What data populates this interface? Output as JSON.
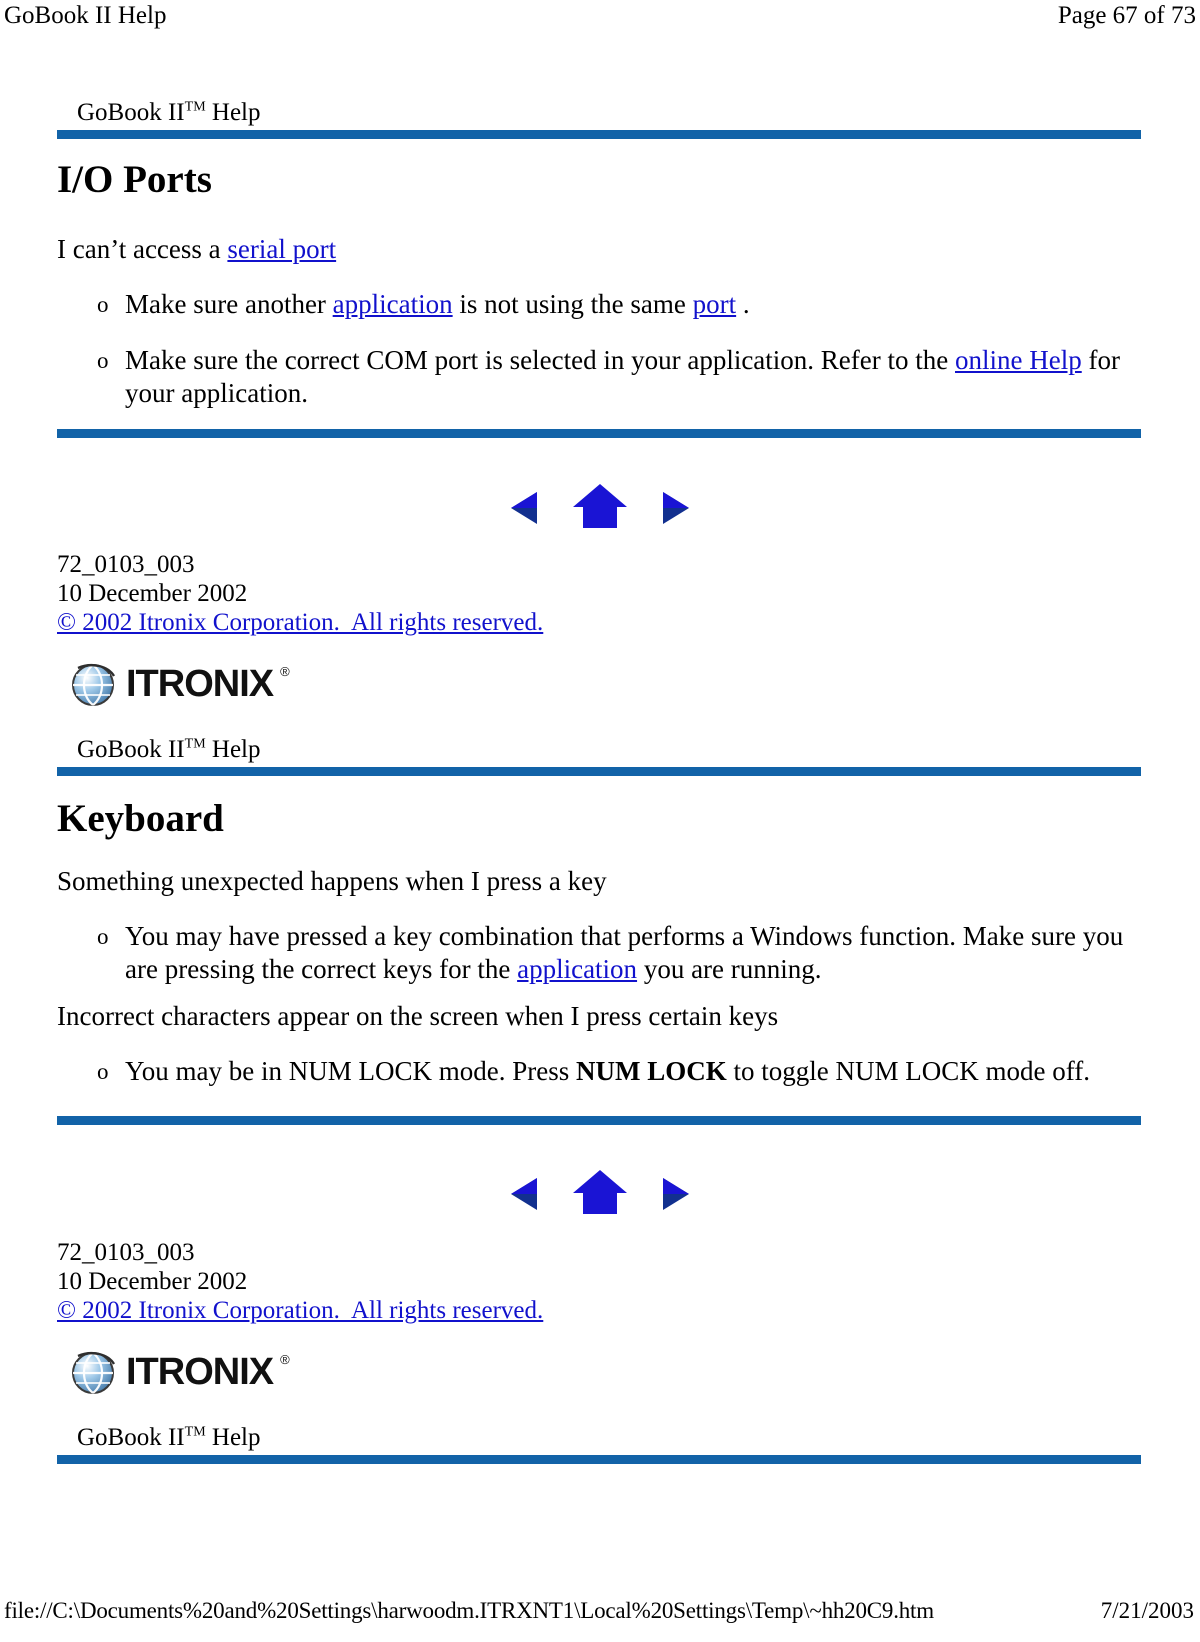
{
  "print_header": {
    "left": "GoBook II Help",
    "right": "Page 67 of 73"
  },
  "print_footer": {
    "path": "file://C:\\Documents%20and%20Settings\\harwoodm.ITRXNT1\\Local%20Settings\\Temp\\~hh20C9.htm",
    "date": "7/21/2003"
  },
  "colors": {
    "rule_blue": "#1263A8",
    "link_blue": "#1111CC",
    "icon_blue": "#1A14D4",
    "icon_blue_dark": "#12308F"
  },
  "banners": {
    "title_prefix": "GoBook II",
    "title_sup": "TM",
    "title_suffix": " Help"
  },
  "sections": [
    {
      "heading": "I/O Ports",
      "intro_prefix": "I can’t access a ",
      "intro_link": "serial port",
      "bullets": [
        {
          "marker": "o",
          "parts": [
            {
              "text": "Make sure another ",
              "type": "text"
            },
            {
              "text": "application",
              "type": "link"
            },
            {
              "text": " is not using the same ",
              "type": "text"
            },
            {
              "text": "port",
              "type": "link"
            },
            {
              "text": " .",
              "type": "text"
            }
          ]
        },
        {
          "marker": "o",
          "parts": [
            {
              "text": "Make sure the correct COM port is selected in your application. Refer to the ",
              "type": "text"
            },
            {
              "text": "online Help",
              "type": "link"
            },
            {
              "text": " for your application.",
              "type": "text"
            }
          ]
        }
      ]
    },
    {
      "heading": "Keyboard",
      "intro_prefix": "Something unexpected happens when I press a key",
      "intro_link": "",
      "bullets": [
        {
          "marker": "o",
          "parts": [
            {
              "text": "You may have pressed a key combination that performs a Windows function. Make sure you are pressing the correct keys for the ",
              "type": "text"
            },
            {
              "text": "application",
              "type": "link"
            },
            {
              "text": " you are running.",
              "type": "text"
            }
          ]
        }
      ],
      "second_intro": "Incorrect characters appear on the screen when I press certain keys",
      "bullets2": [
        {
          "marker": "o",
          "parts": [
            {
              "text": "You may be in NUM LOCK mode. Press ",
              "type": "text"
            },
            {
              "text": "NUM LOCK",
              "type": "bold"
            },
            {
              "text": " to toggle NUM LOCK mode off.",
              "type": "text"
            }
          ]
        }
      ]
    }
  ],
  "navigation": {
    "back_label": "Back",
    "home_label": "Home",
    "forward_label": "Forward"
  },
  "docinfo": {
    "doc_id": "72_0103_003",
    "date": "10 December 2002",
    "copyright": "© 2002 Itronix Corporation.  All rights reserved."
  },
  "logo": {
    "word": "ITRONIX",
    "registered": "®"
  }
}
